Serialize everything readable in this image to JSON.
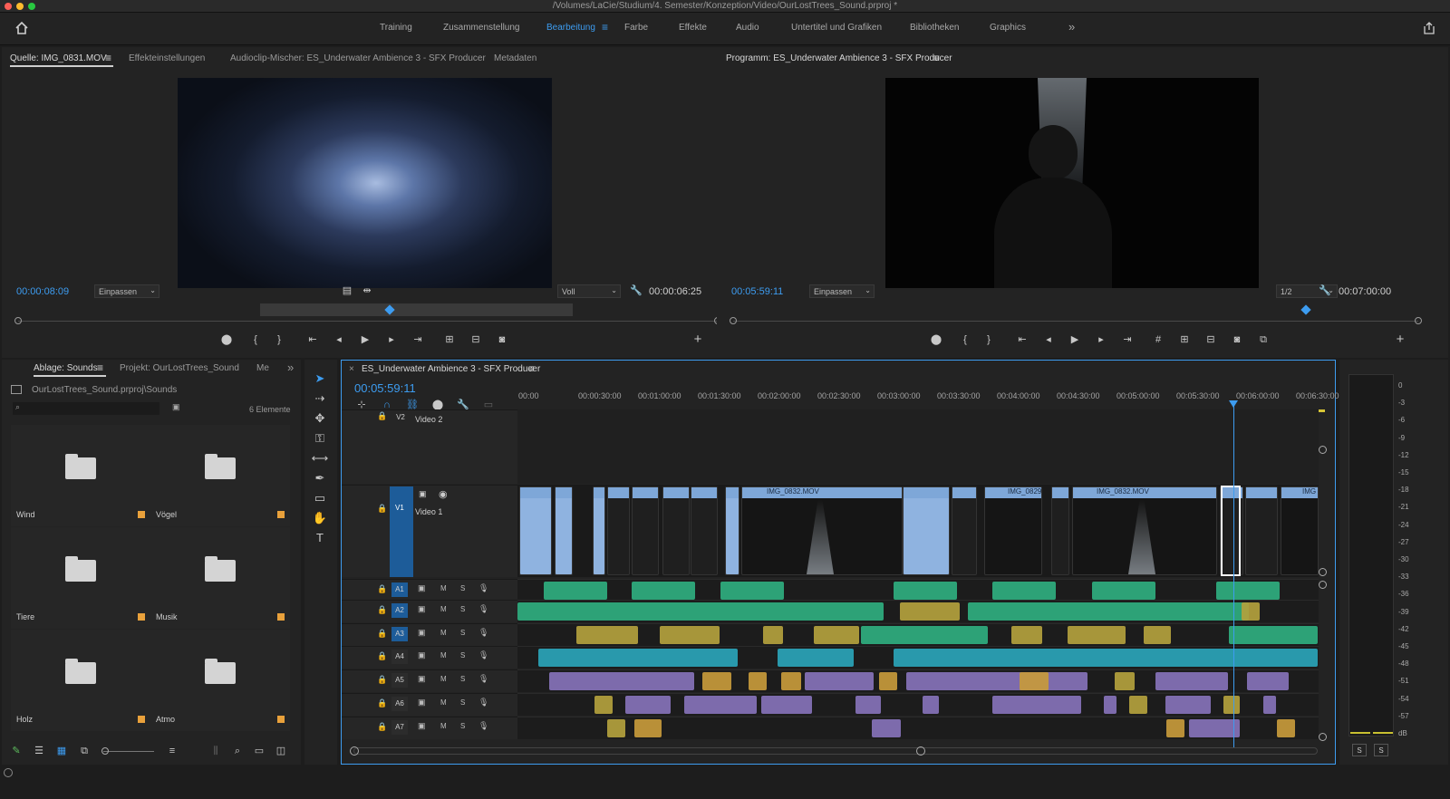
{
  "window": {
    "title": "/Volumes/LaCie/Studium/4. Semester/Konzeption/Video/OurLostTrees_Sound.prproj *"
  },
  "workspaces": [
    "Training",
    "Zusammenstellung",
    "Bearbeitung",
    "Farbe",
    "Effekte",
    "Audio",
    "Untertitel und Grafiken",
    "Bibliotheken",
    "Graphics"
  ],
  "workspace_overflow": "»",
  "source_panel": {
    "tabs": [
      "Quelle: IMG_0831.MOV",
      "Effekteinstellungen",
      "Audioclip-Mischer: ES_Underwater Ambience 3 - SFX Producer",
      "Metadaten"
    ],
    "timecode": "00:00:08:09",
    "fit": "Einpassen",
    "quality": "Voll",
    "duration": "00:00:06:25",
    "playhead_fraction": 0.53
  },
  "program_panel": {
    "tab": "Programm: ES_Underwater Ambience 3 - SFX Producer",
    "timecode": "00:05:59:11",
    "fit": "Einpassen",
    "quality": "1/2",
    "duration": "00:07:00:00",
    "playhead_fraction": 0.86
  },
  "project_panel": {
    "tabs": [
      "Ablage: Sounds",
      "Projekt: OurLostTrees_Sound",
      "Me"
    ],
    "path": "OurLostTrees_Sound.prproj\\Sounds",
    "search_placeholder": "",
    "count": "6 Elemente",
    "bins": [
      {
        "name": "Wind"
      },
      {
        "name": "Vögel"
      },
      {
        "name": "Tiere"
      },
      {
        "name": "Musik"
      },
      {
        "name": "Holz"
      },
      {
        "name": "Atmo"
      }
    ]
  },
  "timeline": {
    "tab": "ES_Underwater Ambience 3 - SFX Producer",
    "timecode": "00:05:59:11",
    "ruler": [
      "00:00",
      "00:00:30:00",
      "00:01:00:00",
      "00:01:30:00",
      "00:02:00:00",
      "00:02:30:00",
      "00:03:00:00",
      "00:03:30:00",
      "00:04:00:00",
      "00:04:30:00",
      "00:05:00:00",
      "00:05:30:00",
      "00:06:00:00",
      "00:06:30:00"
    ],
    "video_tracks": [
      {
        "id": "V2",
        "name": "Video 2"
      },
      {
        "id": "V1",
        "name": "Video 1"
      }
    ],
    "audio_tracks": [
      "A1",
      "A2",
      "A3",
      "A4",
      "A5",
      "A6",
      "A7"
    ],
    "clip_labels": {
      "c1": "IMG_0832.MOV",
      "c2": "IMG_0829",
      "c3": "IMG_0832.MOV",
      "c4": "IMG"
    },
    "mute": "M",
    "solo": "S"
  },
  "meters": {
    "scale": [
      "0",
      "-3",
      "-6",
      "-9",
      "-12",
      "-15",
      "-18",
      "-21",
      "-24",
      "-27",
      "-30",
      "-33",
      "-36",
      "-39",
      "-42",
      "-45",
      "-48",
      "-51",
      "-54",
      "-57",
      "dB"
    ],
    "solo_left": "S",
    "solo_right": "S"
  },
  "colors": {
    "accent": "#3d9cf0",
    "audio_green": "#2fae7f",
    "audio_teal": "#2aa4b8",
    "audio_purple": "#8672b8",
    "audio_yellow": "#b3a13d",
    "video_clip": "#8fb3e0"
  }
}
